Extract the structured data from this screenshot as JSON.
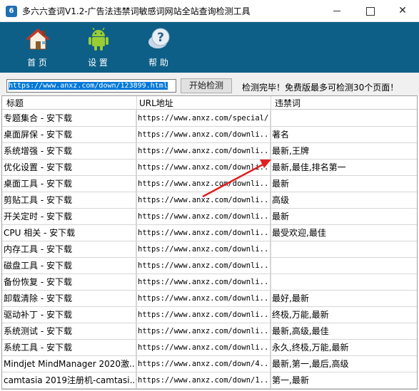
{
  "window": {
    "title": "多六六查词V1.2-广告法违禁词敏感词网站全站查询检测工具",
    "app_icon": "6"
  },
  "toolbar": {
    "home_label": "首 页",
    "settings_label": "设 置",
    "help_label": "帮 助"
  },
  "search": {
    "url_value": "https://www.anxz.com/down/123899.html",
    "check_button": "开始检测",
    "status": "检测完毕！免费版最多可检测30个页面！"
  },
  "table": {
    "headers": [
      "标题",
      "URL地址",
      "违禁词"
    ],
    "rows": [
      {
        "title": "专题集合 - 安下载",
        "url": "https://www.anxz.com/special/",
        "words": ""
      },
      {
        "title": "桌面屏保  - 安下载",
        "url": "https://www.anxz.com/downli...",
        "words": "著名"
      },
      {
        "title": "系统增强  - 安下载",
        "url": "https://www.anxz.com/downli...",
        "words": "最新,王牌"
      },
      {
        "title": "优化设置  - 安下载",
        "url": "https://www.anxz.com/downli...",
        "words": "最新,最佳,排名第一"
      },
      {
        "title": "桌面工具  - 安下载",
        "url": "https://www.anxz.com/downli...",
        "words": "最新"
      },
      {
        "title": "剪贴工具  - 安下载",
        "url": "https://www.anxz.com/downli...",
        "words": "高级"
      },
      {
        "title": "开关定时  - 安下载",
        "url": "https://www.anxz.com/downli...",
        "words": "最新"
      },
      {
        "title": "CPU 相关  - 安下载",
        "url": "https://www.anxz.com/downli...",
        "words": "最受欢迎,最佳"
      },
      {
        "title": "内存工具  - 安下载",
        "url": "https://www.anxz.com/downli...",
        "words": ""
      },
      {
        "title": "磁盘工具  - 安下载",
        "url": "https://www.anxz.com/downli...",
        "words": ""
      },
      {
        "title": "备份恢复  - 安下载",
        "url": "https://www.anxz.com/downli...",
        "words": ""
      },
      {
        "title": "卸载清除  - 安下载",
        "url": "https://www.anxz.com/downli...",
        "words": "最好,最新"
      },
      {
        "title": "驱动补丁  - 安下载",
        "url": "https://www.anxz.com/downli...",
        "words": "终极,万能,最新"
      },
      {
        "title": "系统测试  - 安下载",
        "url": "https://www.anxz.com/downli...",
        "words": "最新,高级,最佳"
      },
      {
        "title": "系统工具  - 安下载",
        "url": "https://www.anxz.com/downli...",
        "words": "永久,终极,万能,最新"
      },
      {
        "title": "Mindjet MindManager 2020激...",
        "url": "https://www.anxz.com/down/4...",
        "words": "最新,第一,最后,高级"
      },
      {
        "title": "camtasia 2019注册机-camtasi...",
        "url": "https://www.anxz.com/down/1...",
        "words": "第一,最新"
      }
    ]
  },
  "colors": {
    "toolbar_bg": "#0d5f87",
    "arrow": "#e02020",
    "selection": "#0078d7"
  },
  "icons": {
    "home": "house-icon",
    "settings": "android-icon",
    "help": "help-question-icon"
  }
}
